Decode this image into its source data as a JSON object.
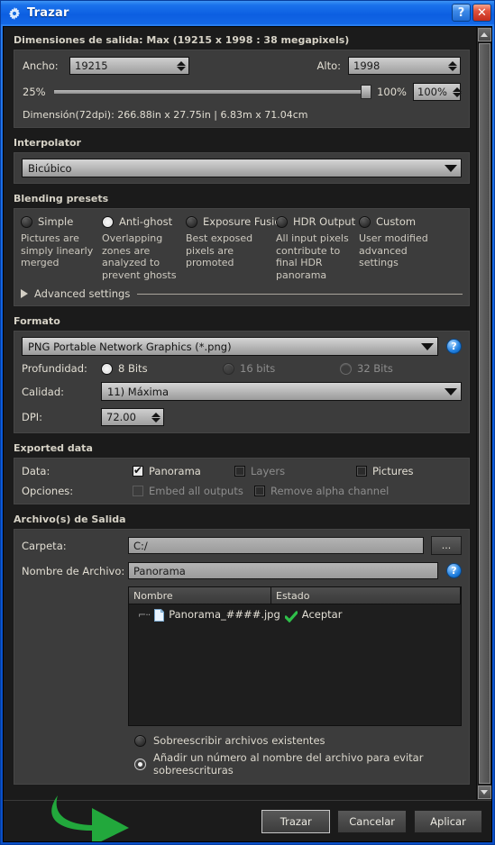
{
  "window": {
    "title": "Trazar",
    "gear_icon": "gear-icon",
    "help_button": "?",
    "close_button": "✕"
  },
  "output_dimensions": {
    "group_title": "Dimensiones de salida: Max (19215 x 1998 : 38 megapixels)",
    "width_label": "Ancho:",
    "width_value": "19215",
    "height_label": "Alto:",
    "height_value": "1998",
    "slider_min_label": "25%",
    "slider_max_label": "100%",
    "zoom_value": "100%",
    "dimension_info": "Dimensión(72dpi): 266.88in x 27.75in |  6.83m x 71.04cm"
  },
  "interpolator": {
    "group_title": "Interpolator",
    "selected": "Bicúbico"
  },
  "blending": {
    "group_title": "Blending presets",
    "presets": [
      {
        "name": "Simple",
        "desc": "Pictures are simply linearly merged",
        "selected": false
      },
      {
        "name": "Anti-ghost",
        "desc": "Overlapping zones are analyzed to prevent ghosts",
        "selected": true
      },
      {
        "name": "Exposure Fusion",
        "desc": "Best exposed pixels are promoted",
        "selected": false
      },
      {
        "name": "HDR Output",
        "desc": "All input pixels contribute to final HDR panorama",
        "selected": false
      },
      {
        "name": "Custom",
        "desc": "User modified advanced settings",
        "selected": false
      }
    ],
    "advanced_label": "Advanced settings"
  },
  "formato": {
    "group_title": "Formato",
    "format_selected": "PNG Portable Network Graphics (*.png)",
    "help_icon": "help-icon",
    "depth_label": "Profundidad:",
    "depth_options": [
      {
        "label": "8 Bits",
        "selected": true,
        "disabled": false
      },
      {
        "label": "16 bits",
        "selected": false,
        "disabled": true
      },
      {
        "label": "32 Bits",
        "selected": false,
        "disabled": true
      }
    ],
    "quality_label": "Calidad:",
    "quality_value": "11) Máxima",
    "dpi_label": "DPI:",
    "dpi_value": "72.00"
  },
  "exported_data": {
    "group_title": "Exported data",
    "data_label": "Data:",
    "data_options": [
      {
        "label": "Panorama",
        "checked": true,
        "disabled": false
      },
      {
        "label": "Layers",
        "checked": false,
        "disabled": true
      },
      {
        "label": "Pictures",
        "checked": false,
        "disabled": false
      }
    ],
    "options_label": "Opciones:",
    "option_items": [
      {
        "label": "Embed all outputs",
        "checked": false,
        "disabled": true
      },
      {
        "label": "Remove alpha channel",
        "checked": false,
        "disabled": true
      }
    ]
  },
  "output_files": {
    "group_title": "Archivo(s) de Salida",
    "folder_label": "Carpeta:",
    "folder_value": "C:/",
    "browse_button": "...",
    "filename_label": "Nombre de Archivo:",
    "filename_value": "Panorama",
    "help_icon": "help-icon",
    "columns": [
      "Nombre",
      "Estado"
    ],
    "rows": [
      {
        "name": "Panorama_####.jpg",
        "state": "Aceptar",
        "state_icon": "check-icon"
      }
    ],
    "overwrite_options": [
      {
        "label": "Sobreescribir archivos existentes",
        "selected": false
      },
      {
        "label": "Añadir un número al nombre del archivo para evitar sobreescrituras",
        "selected": true
      }
    ]
  },
  "footer": {
    "render_button": "Trazar",
    "cancel_button": "Cancelar",
    "apply_button": "Aplicar",
    "arrow_annotation": "green-curved-arrow",
    "arrow_color": "#22a83c"
  }
}
